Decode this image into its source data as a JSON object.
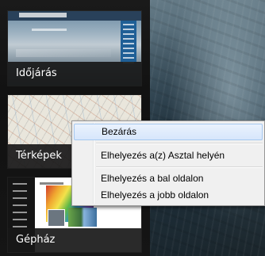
{
  "switcher": {
    "tiles": [
      {
        "label": "Időjárás"
      },
      {
        "label": "Térképek"
      },
      {
        "label": "Gépház"
      }
    ]
  },
  "context_menu": {
    "items": [
      {
        "label": "Bezárás",
        "state": "hover"
      },
      {
        "label": "Elhelyezés a(z) Asztal helyén"
      },
      {
        "label": "Elhelyezés a bal oldalon"
      },
      {
        "label": "Elhelyezés a jobb oldalon"
      }
    ]
  },
  "colors": {
    "menu_background": "#f0f0f0",
    "menu_hover": "#d7e6fb",
    "tile_label_background": "#181818"
  }
}
